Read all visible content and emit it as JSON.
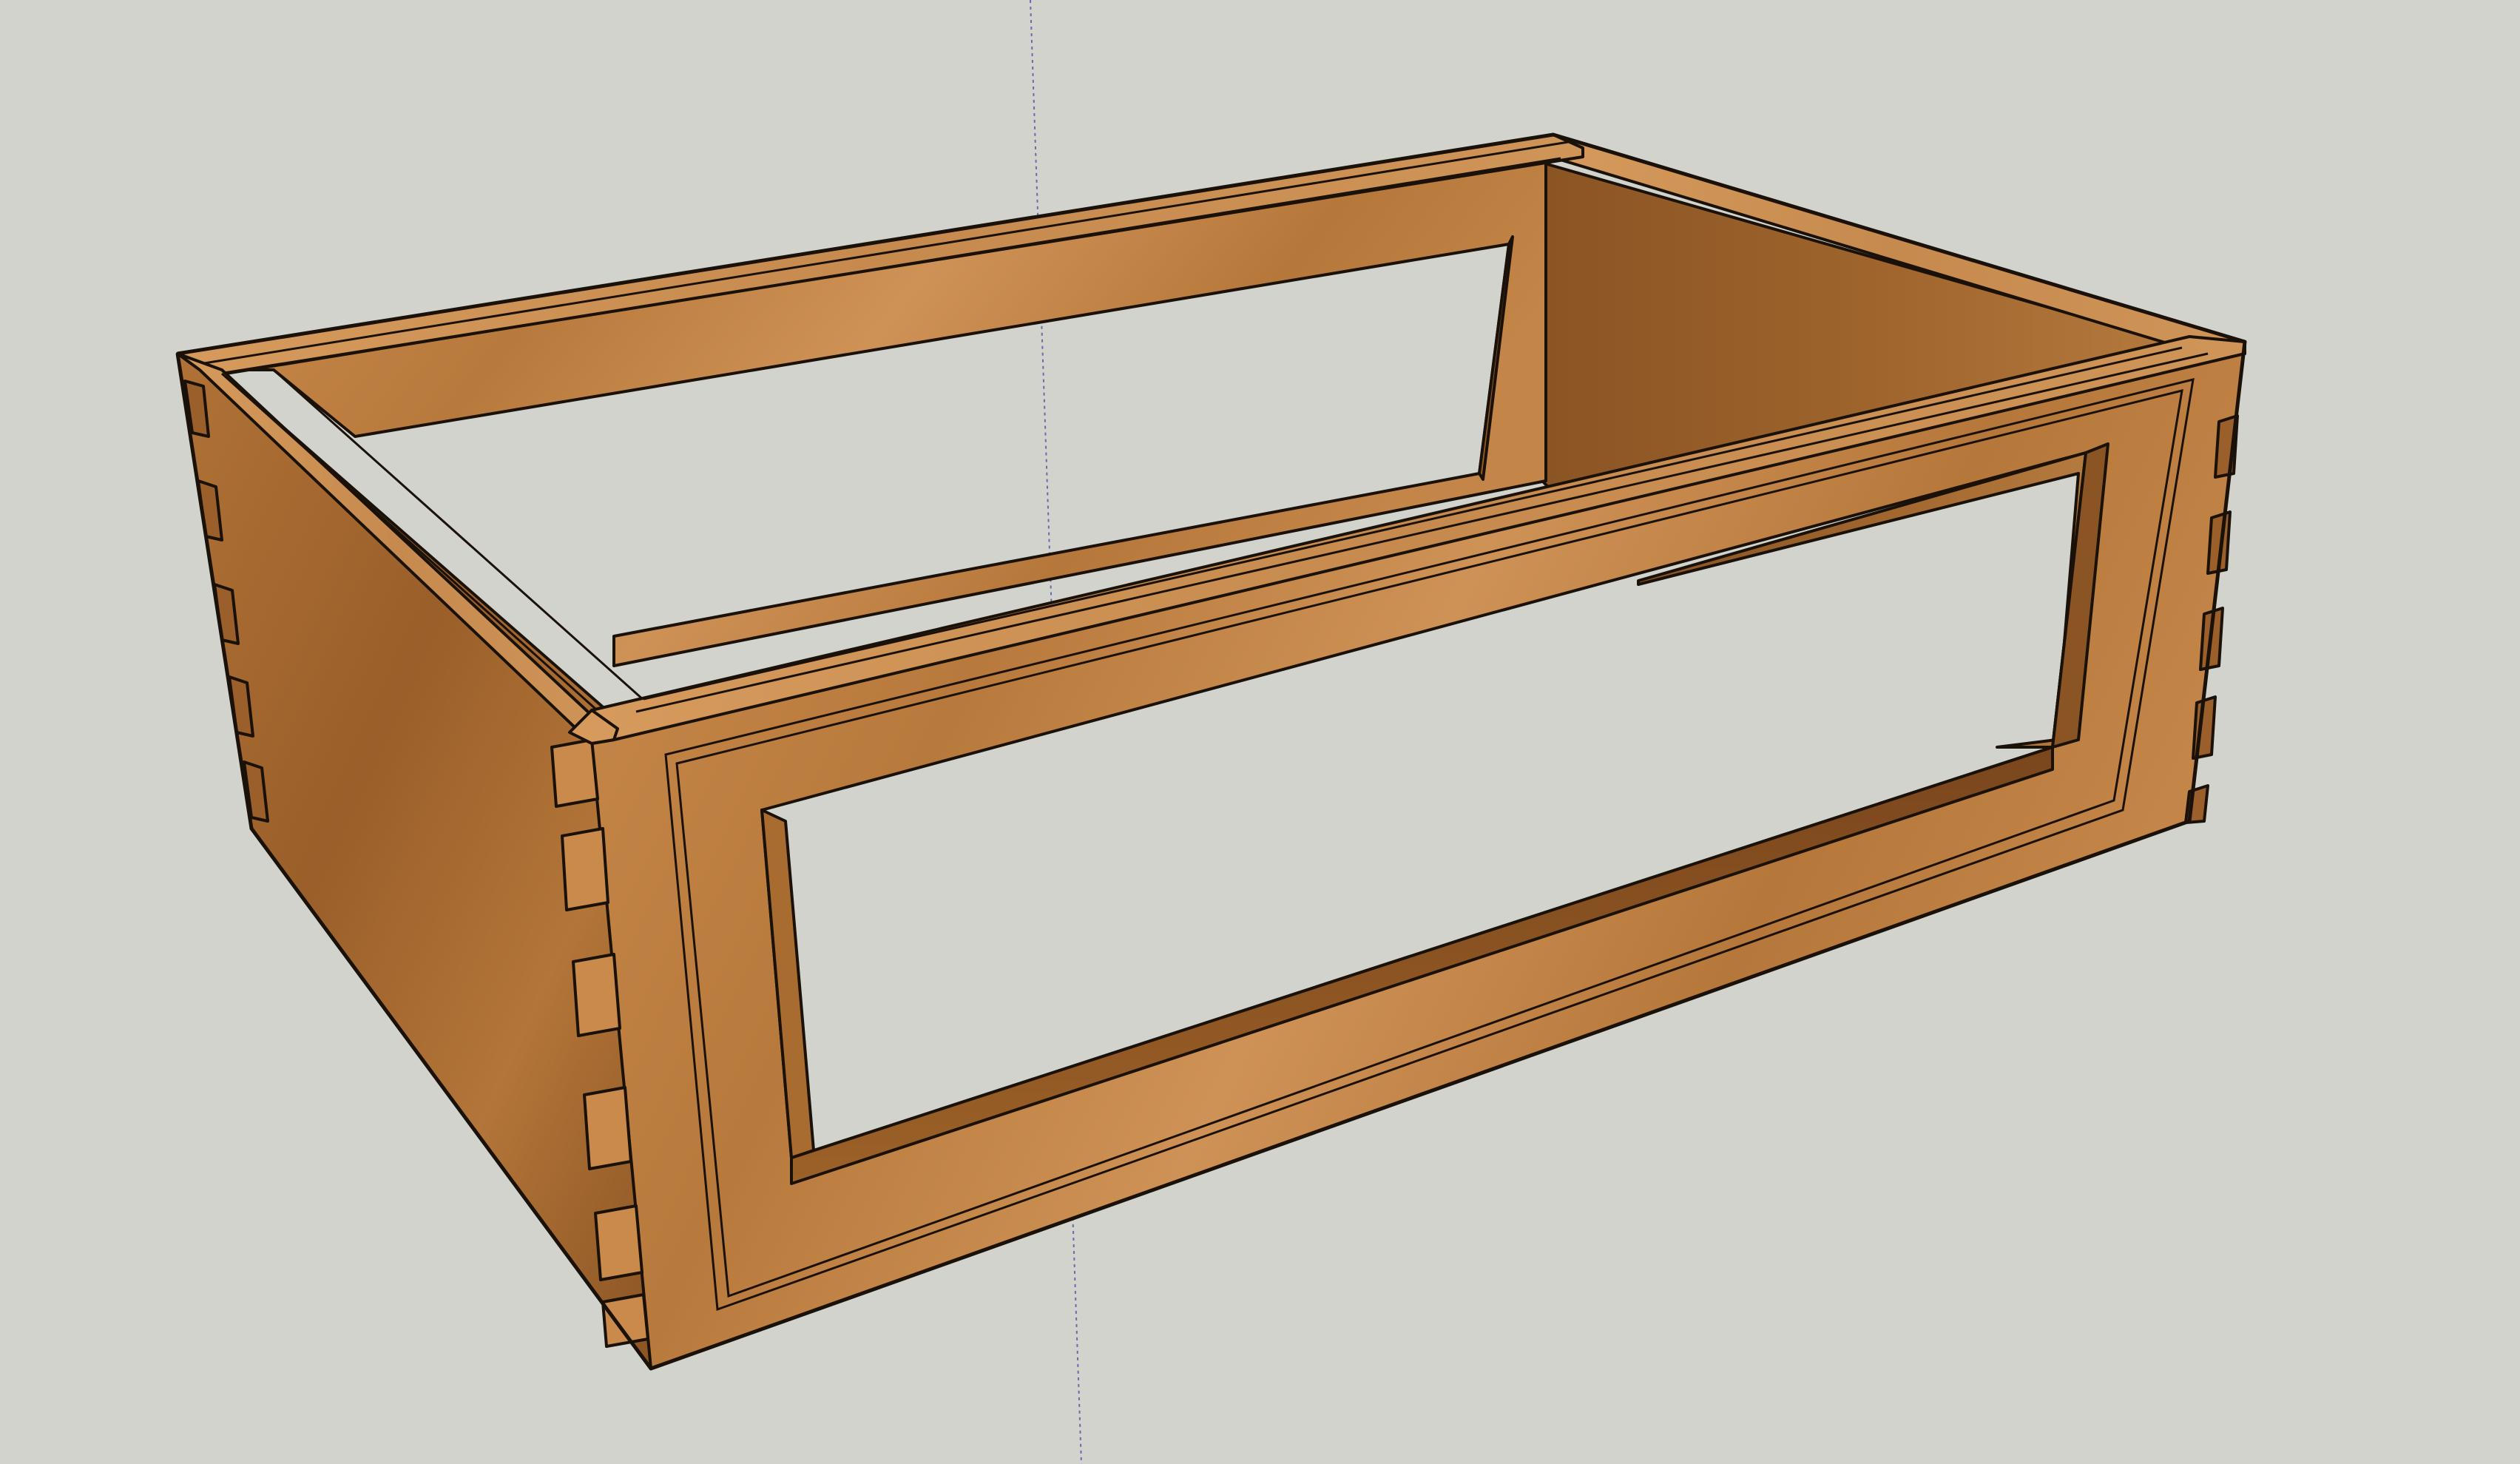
{
  "viewport": {
    "background": "#d3d3ce",
    "axis_color": "#6a6aa8"
  },
  "model": {
    "material_colors": {
      "wood_light": "#c98a4c",
      "wood_mid": "#b07236",
      "wood_dark": "#7e4a1f",
      "edge": "#1a1108"
    },
    "front_dovetails": 9,
    "side_dovetails": 6,
    "right_dovetails": 6
  }
}
